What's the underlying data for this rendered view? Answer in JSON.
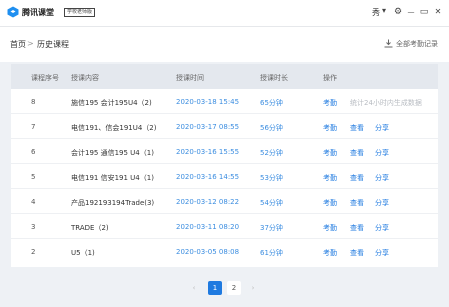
{
  "app": {
    "name": "腾讯课堂",
    "badge": "学校老师版",
    "user": "秀",
    "caret": "▾"
  },
  "window": {
    "settings": "⚙",
    "minimize": "—",
    "restore": "▭",
    "close": "✕"
  },
  "breadcrumb": {
    "home": "首页",
    "separator": ">",
    "current": "历史课程"
  },
  "download": {
    "label": "全部考勤记录"
  },
  "table": {
    "headers": {
      "num": "课程序号",
      "name": "授课内容",
      "time": "授课时间",
      "duration": "授课时长",
      "actions": "操作"
    },
    "rows": [
      {
        "num": "8",
        "name": "施信195 会计195U4（2)",
        "time": "2020-03-18 15:45",
        "duration": "65分钟",
        "a1": "考勤",
        "note": "统计24小时内生成数据"
      },
      {
        "num": "7",
        "name": "电信191、信会191U4（2)",
        "time": "2020-03-17 08:55",
        "duration": "56分钟",
        "a1": "考勤",
        "a2": "查看",
        "a3": "分享"
      },
      {
        "num": "6",
        "name": "会计195 通信195 U4（1)",
        "time": "2020-03-16 15:55",
        "duration": "52分钟",
        "a1": "考勤",
        "a2": "查看",
        "a3": "分享"
      },
      {
        "num": "5",
        "name": "电信191 信安191 U4（1)",
        "time": "2020-03-16 14:55",
        "duration": "53分钟",
        "a1": "考勤",
        "a2": "查看",
        "a3": "分享"
      },
      {
        "num": "4",
        "name": "产品192193194Trade(3)",
        "time": "2020-03-12 08:22",
        "duration": "54分钟",
        "a1": "考勤",
        "a2": "查看",
        "a3": "分享"
      },
      {
        "num": "3",
        "name": "TRADE（2)",
        "time": "2020-03-11 08:20",
        "duration": "37分钟",
        "a1": "考勤",
        "a2": "查看",
        "a3": "分享"
      },
      {
        "num": "2",
        "name": "U5（1)",
        "time": "2020-03-05 08:08",
        "duration": "61分钟",
        "a1": "考勤",
        "a2": "查看",
        "a3": "分享"
      }
    ]
  },
  "pagination": {
    "prev": "‹",
    "pages": [
      "1",
      "2"
    ],
    "next": "›",
    "current": "1"
  },
  "colors": {
    "accent": "#1f7ae0",
    "header_bg": "#e4e8ee",
    "page_bg": "#eef1f5"
  }
}
